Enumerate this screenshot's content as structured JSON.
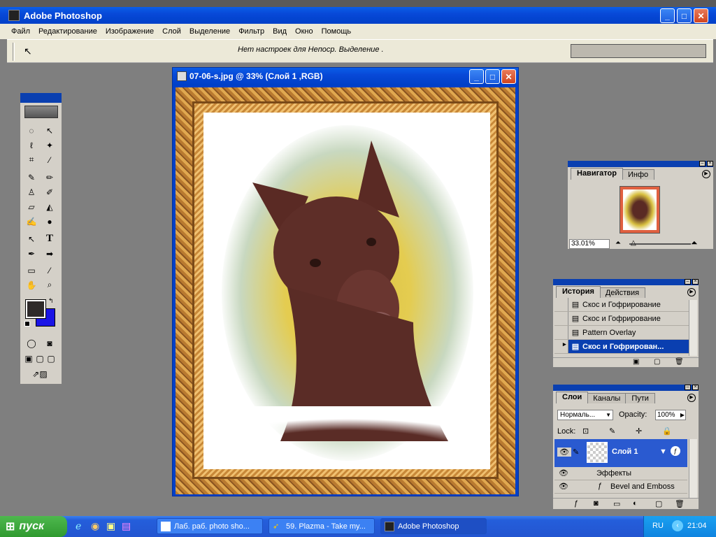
{
  "app": {
    "title": "Adobe Photoshop"
  },
  "menu": [
    "Файл",
    "Редактирование",
    "Изображение",
    "Слой",
    "Выделение",
    "Фильтр",
    "Вид",
    "Окно",
    "Помощь"
  ],
  "options_bar": {
    "message": "Нет настроек для  Непоср. Выделение   ."
  },
  "document": {
    "title": "07-06-s.jpg @ 33% (Слой 1 ,RGB)"
  },
  "navigator": {
    "tabs": [
      "Навигатор",
      "Инфо"
    ],
    "zoom": "33.01%"
  },
  "history": {
    "tabs": [
      "История",
      "Действия"
    ],
    "items": [
      "Скос и Гофрирование",
      "Скос и Гофрирование",
      "Pattern Overlay",
      "Скос и Гофрирован..."
    ]
  },
  "layers": {
    "tabs": [
      "Слои",
      "Каналы",
      "Пути"
    ],
    "blend_mode": "Нормаль...",
    "opacity_label": "Opacity:",
    "opacity": "100%",
    "lock_label": "Lock:",
    "layer_name": "Слой 1",
    "effects_label": "Эффекты",
    "effect_item": "Bevel and Emboss"
  },
  "taskbar": {
    "start": "пуск",
    "tasks": [
      "Лаб. раб. photo sho...",
      "59. Plazma - Take my...",
      "Adobe Photoshop"
    ],
    "lang": "RU",
    "clock": "21:04"
  },
  "colors": {
    "foreground": "#2e2a2a",
    "background": "#1a14e6"
  }
}
